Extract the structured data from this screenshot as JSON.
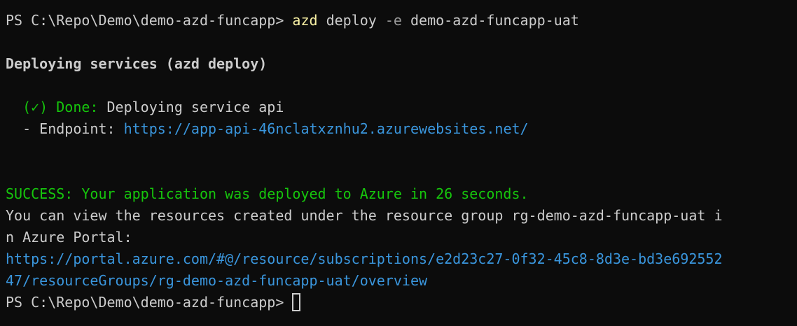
{
  "terminal": {
    "prompt": "PS C:\\Repo\\Demo\\demo-azd-funcapp> ",
    "command": {
      "exe": "azd",
      "subcommand": "deploy",
      "flag": "-e",
      "environment": "demo-azd-funcapp-uat"
    },
    "heading": "Deploying services (azd deploy)",
    "done": {
      "status": "(✓) Done:",
      "text": "Deploying service api"
    },
    "endpoint": {
      "label": "- Endpoint:",
      "url": "https://app-api-46nclatxznhu2.azurewebsites.net/"
    },
    "success": "SUCCESS: Your application was deployed to Azure in 26 seconds.",
    "info_line1": "You can view the resources created under the resource group rg-demo-azd-funcapp-uat i",
    "info_line2": "n Azure Portal:",
    "portal_url_line1": "https://portal.azure.com/#@/resource/subscriptions/e2d23c27-0f32-45c8-8d3e-bd3e692552",
    "portal_url_line2": "47/resourceGroups/rg-demo-azd-funcapp-uat/overview",
    "colors": {
      "background": "#0c0c0c",
      "text": "#cccccc",
      "command": "#f9f1a5",
      "success": "#16c60c",
      "link": "#3a96dd"
    }
  }
}
